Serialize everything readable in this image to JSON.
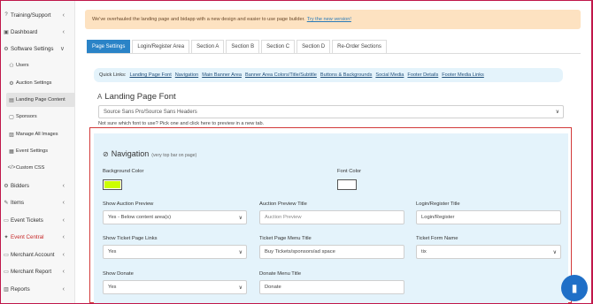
{
  "sidebar": {
    "items": [
      {
        "label": "Training/Support",
        "icon": "help-circle-icon",
        "glyph": "?",
        "chevron": "‹"
      },
      {
        "label": "Dashboard",
        "icon": "dashboard-icon",
        "glyph": "▣",
        "chevron": "‹"
      },
      {
        "label": "Software Settings",
        "icon": "gear-icon",
        "glyph": "⚙",
        "chevron": "∨"
      },
      {
        "label": "Users",
        "icon": "users-icon",
        "glyph": "⚇"
      },
      {
        "label": "Auction Settings",
        "icon": "gear-icon",
        "glyph": "⚙"
      },
      {
        "label": "Landing Page Content",
        "icon": "document-icon",
        "glyph": "▤"
      },
      {
        "label": "Sponsors",
        "icon": "sponsors-icon",
        "glyph": "▢"
      },
      {
        "label": "Manage All Images",
        "icon": "image-icon",
        "glyph": "▨"
      },
      {
        "label": "Event Settings",
        "icon": "calendar-icon",
        "glyph": "▦"
      },
      {
        "label": "Custom CSS",
        "icon": "code-icon",
        "glyph": "</>"
      },
      {
        "label": "Bidders",
        "icon": "gear-icon",
        "glyph": "⚙",
        "chevron": "‹"
      },
      {
        "label": "Items",
        "icon": "items-icon",
        "glyph": "✎",
        "chevron": "‹"
      },
      {
        "label": "Event Tickets",
        "icon": "ticket-icon",
        "glyph": "▭",
        "chevron": "‹"
      },
      {
        "label": "Event Central",
        "icon": "central-icon",
        "glyph": "✦",
        "chevron": "‹"
      },
      {
        "label": "Merchant Account",
        "icon": "merchant-icon",
        "glyph": "▭",
        "chevron": "‹"
      },
      {
        "label": "Merchant Report",
        "icon": "report-icon",
        "glyph": "▭",
        "chevron": "‹"
      },
      {
        "label": "Reports",
        "icon": "reports-icon",
        "glyph": "▥",
        "chevron": "‹"
      }
    ]
  },
  "notice": {
    "text": "We've overhauled the landing page and bidapp with a new design and easier to use page builder.",
    "link": "Try the new version!"
  },
  "tabs": [
    "Page Settings",
    "Login/Register Area",
    "Section A",
    "Section B",
    "Section C",
    "Section D",
    "Re-Order Sections"
  ],
  "quick_links": {
    "label": "Quick Links:",
    "links": [
      "Landing Page Font",
      "Navigation",
      "Main Banner Area",
      "Banner Area Colors/Title/Subtitle",
      "Buttons & Backgrounds",
      "Social Media",
      "Footer Details",
      "Footer Media Links"
    ]
  },
  "landing_font": {
    "title": "Landing Page Font",
    "selected": "Source Sans Pro/Source Sans Headers",
    "hint": "Not sure which font to use? Pick one and click here to preview in a new tab."
  },
  "navigation": {
    "title": "Navigation",
    "subtitle": "(very top bar on page)",
    "background_color_label": "Background Color",
    "font_color_label": "Font Color",
    "background_color": "#ccff00",
    "font_color": "#ffffff",
    "show_auction_preview_label": "Show Auction Preview",
    "show_auction_preview_value": "Yes - Below content area(s)",
    "auction_preview_title_label": "Auction Preview Title",
    "auction_preview_title_placeholder": "Auction Preview",
    "login_register_title_label": "Login/Register Title",
    "login_register_title_value": "Login/Register",
    "show_ticket_links_label": "Show Ticket Page Links",
    "show_ticket_links_value": "Yes",
    "ticket_menu_title_label": "Ticket Page Menu Title",
    "ticket_menu_title_value": "Buy Tickets/sponsors/ad space",
    "ticket_form_name_label": "Ticket Form Name",
    "ticket_form_name_value": "tix",
    "show_donate_label": "Show Donate",
    "show_donate_value": "Yes",
    "donate_menu_title_label": "Donate Menu Title",
    "donate_menu_title_value": "Donate"
  },
  "colors": {
    "accent": "#2a83c7",
    "notice_bg": "#fde2c1",
    "panel_bg": "#e4f3fb",
    "highlight_border": "#d23a3a"
  }
}
